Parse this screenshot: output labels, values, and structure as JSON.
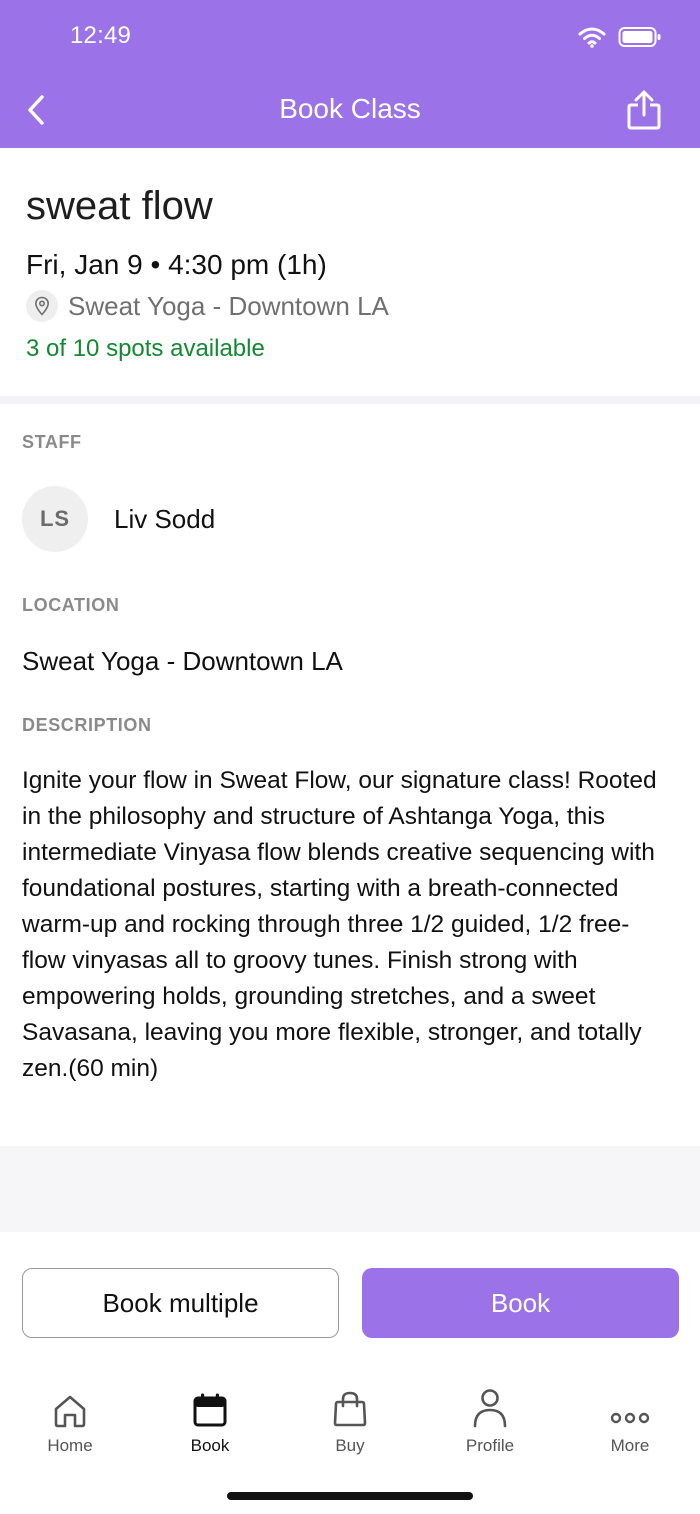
{
  "status_bar": {
    "time": "12:49"
  },
  "header": {
    "title": "Book Class"
  },
  "class_info": {
    "name": "sweat flow",
    "datetime": "Fri, Jan 9 • 4:30 pm (1h)",
    "location": "Sweat Yoga - Downtown LA",
    "spots": "3 of 10 spots available"
  },
  "staff": {
    "label": "STAFF",
    "initials": "LS",
    "name": "Liv Sodd"
  },
  "location_section": {
    "label": "LOCATION",
    "value": "Sweat Yoga - Downtown LA"
  },
  "description_section": {
    "label": "DESCRIPTION",
    "text": "Ignite your flow in Sweat Flow, our signature class! Rooted in the philosophy and structure of Ashtanga Yoga, this intermediate Vinyasa flow blends creative sequencing with foundational postures, starting with a breath-connected warm-up and rocking through three 1/2 guided, 1/2 free-flow vinyasas all to groovy tunes. Finish strong with empowering holds, grounding stretches, and a sweet Savasana, leaving you more flexible, stronger, and totally zen.(60 min)"
  },
  "actions": {
    "book_multiple": "Book multiple",
    "book": "Book"
  },
  "tabbar": {
    "items": [
      {
        "label": "Home",
        "icon": "home-icon"
      },
      {
        "label": "Book",
        "icon": "calendar-icon"
      },
      {
        "label": "Buy",
        "icon": "shopping-bag-icon"
      },
      {
        "label": "Profile",
        "icon": "person-icon"
      },
      {
        "label": "More",
        "icon": "more-dots-icon"
      }
    ],
    "active": "Book"
  },
  "colors": {
    "brand": "#9b72e8",
    "available": "#138a32"
  }
}
